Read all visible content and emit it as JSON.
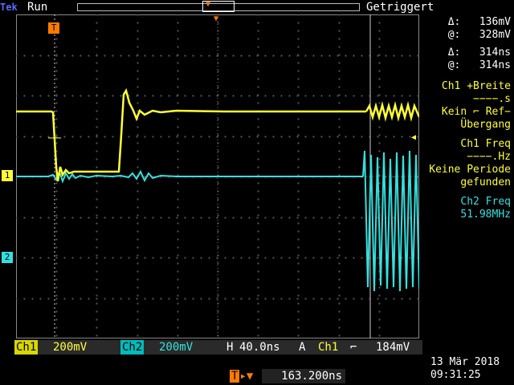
{
  "top": {
    "brand": "Tek",
    "run_status": "Run",
    "trigger_status": "Getriggert"
  },
  "markers": {
    "trigger_position": "T",
    "ch1_marker": "1",
    "ch2_marker": "2"
  },
  "cursor_readouts": {
    "ch1_delta_label": "Δ:",
    "ch1_delta_value": "136mV",
    "ch1_at_label": "@:",
    "ch1_at_value": "328mV",
    "time_delta_label": "Δ:",
    "time_delta_value": "314ns",
    "time_at_label": "@:",
    "time_at_value": "314ns"
  },
  "measurements": [
    {
      "title": "Ch1 +Breite",
      "value": "−−−−.s",
      "note": "Kein ⌐ Ref−\nÜbergang",
      "color": "#ffff33"
    },
    {
      "title": "Ch1 Freq",
      "value": "−−−−.Hz",
      "note": "Keine Periode\ngefunden",
      "color": "#ffff33"
    },
    {
      "title": "Ch2 Freq",
      "value": "51.98MHz",
      "note": "",
      "color": "#33e0e0"
    }
  ],
  "bottom": {
    "ch1_label": "Ch1",
    "ch1_scale": "200mV",
    "ch2_label": "Ch2",
    "ch2_scale": "200mV",
    "horizontal_label": "H",
    "horizontal_scale": "40.0ns",
    "trigger_mode": "A",
    "trigger_source": "Ch1",
    "trigger_slope": "⌐",
    "trigger_level": "184mV",
    "trigger_offset_value": "163.200ns",
    "date": "13 Mär 2018",
    "time": "09:31:25"
  },
  "colors": {
    "ch1": "#ffff33",
    "ch2": "#33e0e0",
    "trigger": "#ff7b00"
  }
}
